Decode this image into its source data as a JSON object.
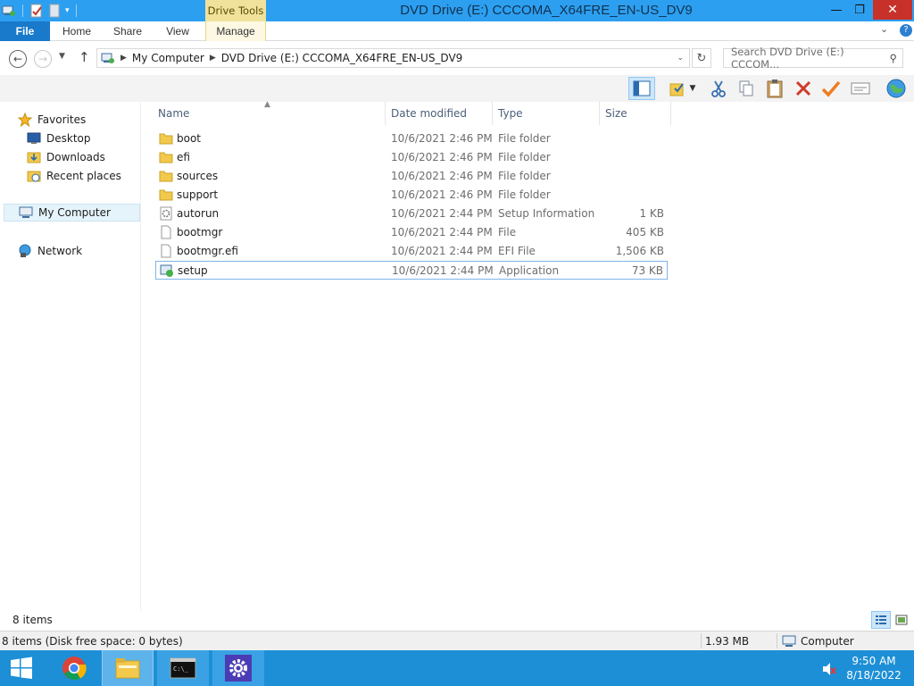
{
  "window": {
    "title": "DVD Drive (E:) CCCOMA_X64FRE_EN-US_DV9",
    "context_tab_header": "Drive Tools",
    "minimize_glyph": "—",
    "maximize_glyph": "❐",
    "close_glyph": "✕"
  },
  "ribbon": {
    "tabs": [
      "File",
      "Home",
      "Share",
      "View",
      "Manage"
    ],
    "collapse_glyph": "⌄",
    "help_glyph": "?"
  },
  "address": {
    "segments": [
      "My Computer",
      "DVD Drive (E:) CCCOMA_X64FRE_EN-US_DV9"
    ],
    "search_placeholder": "Search DVD Drive (E:) CCCOM..."
  },
  "navpane": {
    "favorites_label": "Favorites",
    "favorites": [
      "Desktop",
      "Downloads",
      "Recent places"
    ],
    "computer_label": "My Computer",
    "network_label": "Network"
  },
  "columns": {
    "name": "Name",
    "date_modified": "Date modified",
    "type": "Type",
    "size": "Size"
  },
  "files": [
    {
      "name": "boot",
      "date": "10/6/2021 2:46 PM",
      "type": "File folder",
      "size": "",
      "icon": "folder-icon"
    },
    {
      "name": "efi",
      "date": "10/6/2021 2:46 PM",
      "type": "File folder",
      "size": "",
      "icon": "folder-icon"
    },
    {
      "name": "sources",
      "date": "10/6/2021 2:46 PM",
      "type": "File folder",
      "size": "",
      "icon": "folder-icon"
    },
    {
      "name": "support",
      "date": "10/6/2021 2:46 PM",
      "type": "File folder",
      "size": "",
      "icon": "folder-icon"
    },
    {
      "name": "autorun",
      "date": "10/6/2021 2:44 PM",
      "type": "Setup Information",
      "size": "1 KB",
      "icon": "setup-info-icon"
    },
    {
      "name": "bootmgr",
      "date": "10/6/2021 2:44 PM",
      "type": "File",
      "size": "405 KB",
      "icon": "file-icon"
    },
    {
      "name": "bootmgr.efi",
      "date": "10/6/2021 2:44 PM",
      "type": "EFI File",
      "size": "1,506 KB",
      "icon": "file-icon"
    },
    {
      "name": "setup",
      "date": "10/6/2021 2:44 PM",
      "type": "Application",
      "size": "73 KB",
      "icon": "application-icon"
    }
  ],
  "status": {
    "item_count": "8 items",
    "summary": "8 items (Disk free space: 0 bytes)",
    "size": "1.93 MB",
    "location": "Computer"
  },
  "taskbar": {
    "clock_time": "9:50 AM",
    "clock_date": "8/18/2022",
    "apps": [
      "windows-start-icon",
      "chrome-icon",
      "file-explorer-icon",
      "command-prompt-icon",
      "settings-gear-icon"
    ]
  },
  "colors": {
    "titlebar": "#2d9ff0",
    "file_tab": "#1979ca",
    "taskbar": "#1d8fd6",
    "selection_border": "#7eb4ea"
  }
}
